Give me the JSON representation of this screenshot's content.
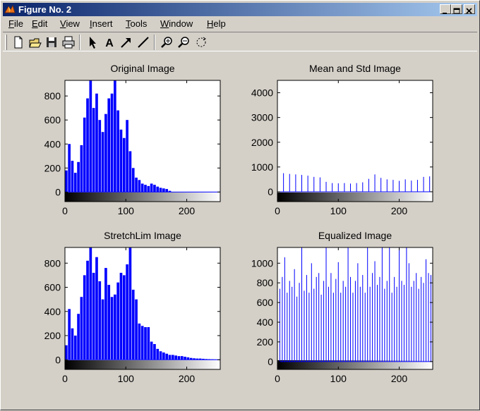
{
  "window": {
    "title": "Figure No. 2"
  },
  "menu": [
    {
      "label": "File",
      "u": "F",
      "rest": "ile",
      "name": "menu-file"
    },
    {
      "label": "Edit",
      "u": "E",
      "rest": "dit",
      "name": "menu-edit"
    },
    {
      "label": "View",
      "u": "V",
      "rest": "iew",
      "name": "menu-view"
    },
    {
      "label": "Insert",
      "u": "I",
      "rest": "nsert",
      "name": "menu-insert"
    },
    {
      "label": "Tools",
      "u": "T",
      "rest": "ools",
      "name": "menu-tools"
    },
    {
      "label": "Window",
      "u": "W",
      "rest": "indow",
      "name": "menu-window"
    },
    {
      "label": "Help",
      "u": "H",
      "rest": "elp",
      "name": "menu-help"
    }
  ],
  "toolbar": [
    {
      "name": "new-figure-icon"
    },
    {
      "name": "open-file-icon"
    },
    {
      "name": "save-icon"
    },
    {
      "name": "print-icon"
    },
    {
      "name": "select-arrow-icon"
    },
    {
      "name": "insert-text-icon"
    },
    {
      "name": "insert-arrow-icon"
    },
    {
      "name": "insert-line-icon"
    },
    {
      "name": "zoom-in-icon"
    },
    {
      "name": "zoom-out-icon"
    },
    {
      "name": "rotate-3d-icon"
    }
  ],
  "chart_data": [
    {
      "type": "bar",
      "title": "Original Image",
      "xlim": [
        0,
        255
      ],
      "ylim": [
        -80,
        930
      ],
      "xticks": [
        0,
        100,
        200
      ],
      "yticks": [
        0,
        200,
        400,
        600,
        800
      ],
      "color": "#0000ff",
      "colorbar": "grayscale",
      "x": [
        0,
        5,
        10,
        15,
        20,
        25,
        30,
        35,
        40,
        45,
        50,
        55,
        60,
        65,
        70,
        75,
        80,
        85,
        90,
        95,
        100,
        105,
        110,
        115,
        120,
        125,
        130,
        135,
        140,
        145,
        150,
        155,
        160,
        165,
        170,
        175
      ],
      "values": [
        180,
        400,
        260,
        160,
        250,
        390,
        620,
        780,
        930,
        700,
        820,
        600,
        500,
        650,
        780,
        820,
        930,
        680,
        520,
        450,
        600,
        340,
        200,
        120,
        100,
        70,
        60,
        50,
        70,
        60,
        45,
        35,
        30,
        25,
        10,
        0
      ]
    },
    {
      "type": "bar",
      "title": "Mean and Std Image",
      "xlim": [
        0,
        255
      ],
      "ylim": [
        -400,
        4500
      ],
      "xticks": [
        0,
        100,
        200
      ],
      "yticks": [
        0,
        1000,
        2000,
        3000,
        4000
      ],
      "color": "#0000ff",
      "colorbar": "grayscale",
      "x": [
        0,
        10,
        20,
        30,
        40,
        50,
        60,
        70,
        80,
        90,
        100,
        110,
        120,
        130,
        140,
        150,
        160,
        170,
        180,
        190,
        200,
        210,
        220,
        230,
        240,
        250
      ],
      "values": [
        4450,
        750,
        720,
        700,
        680,
        650,
        600,
        580,
        400,
        350,
        340,
        350,
        330,
        350,
        380,
        520,
        700,
        560,
        500,
        480,
        440,
        500,
        450,
        480,
        600,
        620
      ]
    },
    {
      "type": "bar",
      "title": "StretchLim Image",
      "xlim": [
        0,
        255
      ],
      "ylim": [
        -80,
        930
      ],
      "xticks": [
        0,
        100,
        200
      ],
      "yticks": [
        0,
        200,
        400,
        600,
        800
      ],
      "color": "#0000ff",
      "colorbar": "grayscale",
      "x": [
        0,
        5,
        10,
        15,
        20,
        25,
        30,
        35,
        40,
        45,
        50,
        55,
        60,
        65,
        70,
        75,
        80,
        85,
        90,
        95,
        100,
        105,
        110,
        115,
        120,
        125,
        130,
        135,
        140,
        145,
        150,
        155,
        160,
        165,
        170,
        175,
        180,
        185,
        190,
        195,
        200,
        205,
        210,
        215,
        220,
        225,
        230,
        235,
        240,
        245
      ],
      "values": [
        120,
        420,
        260,
        200,
        380,
        520,
        700,
        820,
        930,
        720,
        850,
        650,
        500,
        760,
        620,
        520,
        540,
        640,
        720,
        700,
        790,
        930,
        580,
        500,
        300,
        280,
        270,
        270,
        150,
        130,
        90,
        70,
        60,
        50,
        40,
        40,
        35,
        30,
        30,
        25,
        20,
        15,
        12,
        10,
        10,
        8,
        6,
        5,
        4,
        3
      ]
    },
    {
      "type": "bar",
      "title": "Equalized Image",
      "xlim": [
        0,
        255
      ],
      "ylim": [
        -80,
        1160
      ],
      "xticks": [
        0,
        100,
        200
      ],
      "yticks": [
        0,
        200,
        400,
        600,
        800,
        1000
      ],
      "color": "#0000ff",
      "colorbar": "grayscale",
      "x": [
        0,
        4,
        8,
        12,
        16,
        20,
        24,
        28,
        32,
        36,
        40,
        44,
        48,
        52,
        56,
        60,
        64,
        68,
        72,
        76,
        80,
        84,
        88,
        92,
        96,
        100,
        104,
        108,
        112,
        116,
        120,
        124,
        128,
        132,
        136,
        140,
        144,
        148,
        152,
        156,
        160,
        164,
        168,
        172,
        176,
        180,
        184,
        188,
        192,
        196,
        200,
        204,
        208,
        212,
        216,
        220,
        224,
        228,
        232,
        236,
        240,
        244,
        248,
        252
      ],
      "values": [
        920,
        740,
        860,
        1060,
        700,
        820,
        760,
        940,
        660,
        800,
        1160,
        720,
        880,
        700,
        1000,
        740,
        860,
        900,
        680,
        820,
        1160,
        760,
        900,
        700,
        840,
        1010,
        700,
        820,
        760,
        1160,
        860,
        700,
        820,
        1000,
        760,
        880,
        700,
        1160,
        760,
        900,
        1020,
        780,
        860,
        1160,
        740,
        820,
        1160,
        700,
        860,
        760,
        1160,
        820,
        780,
        1160,
        1000,
        760,
        820,
        900,
        740,
        860,
        800,
        1040,
        900,
        880
      ]
    }
  ]
}
